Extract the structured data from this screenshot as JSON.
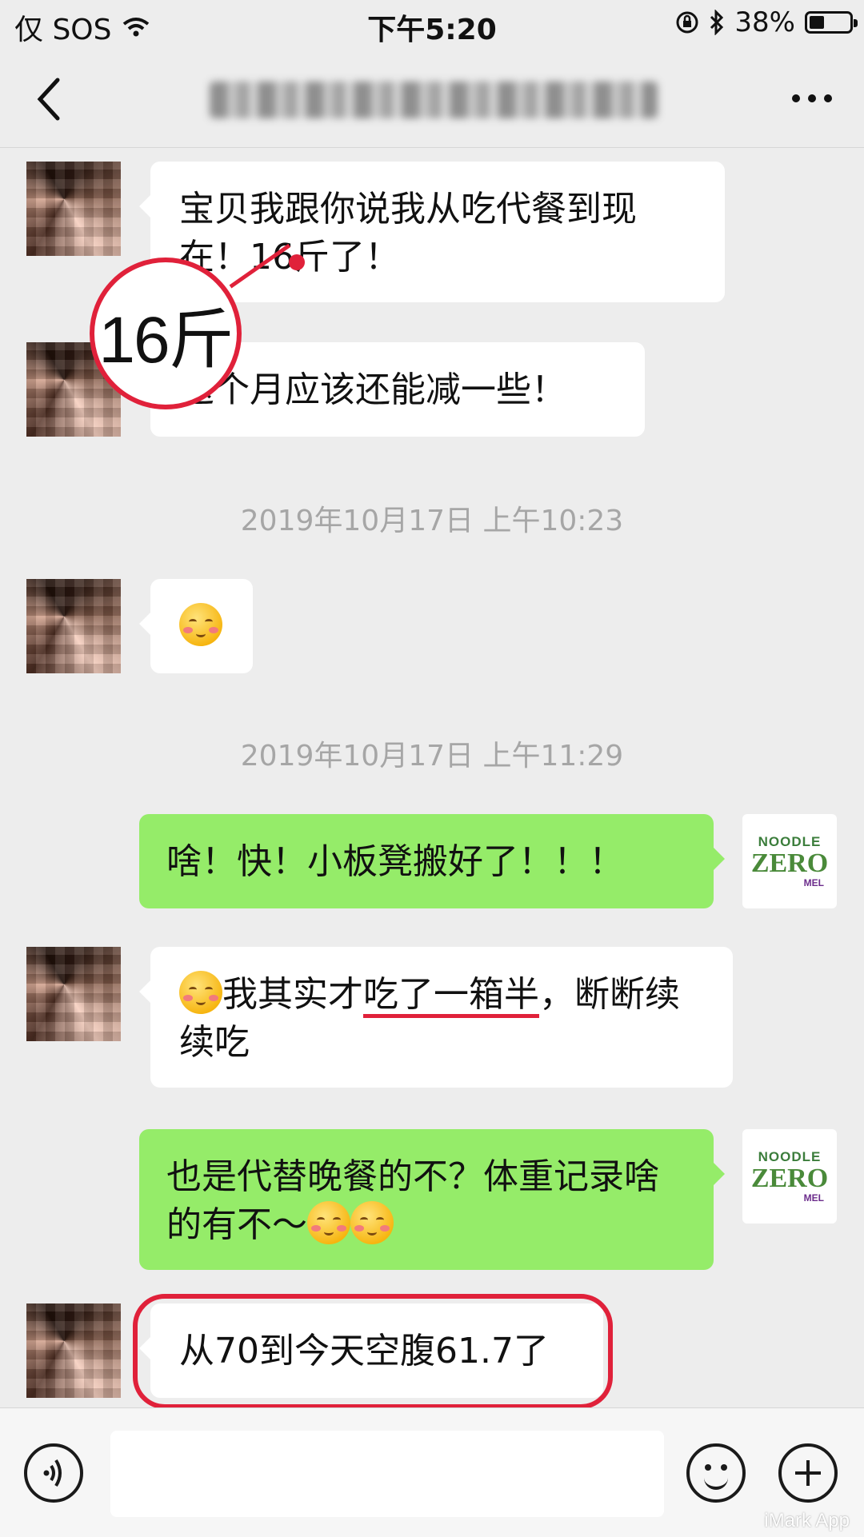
{
  "status_bar": {
    "carrier": "仅 SOS",
    "time": "下午5:20",
    "battery": "38%",
    "battery_level": 0.38
  },
  "nav": {
    "title": "聊天"
  },
  "messages": {
    "m1": "宝贝我跟你说我从吃代餐到现在！16斤了！",
    "m2": "这个月应该还能减一些！",
    "t1": "2019年10月17日 上午10:23",
    "t2": "2019年10月17日 上午11:29",
    "m4": "啥！快！小板凳搬好了！！！",
    "m5a": "我其实才",
    "m5b": "吃了一箱半",
    "m5c": "，断断续续吃",
    "m6": "也是代替晚餐的不？体重记录啥的有不～",
    "m7": "从70到今天空腹61.7了"
  },
  "annotation": {
    "circle_text": "16斤"
  },
  "avatar_right": {
    "line1": "NOODLE",
    "line2": "ZERO",
    "line3": "MEL"
  },
  "watermark": "iMark App",
  "icons": [
    "wifi-icon",
    "lock-rotation-icon",
    "bluetooth-icon",
    "battery-icon",
    "back-icon",
    "more-icon",
    "voice-icon",
    "emoji-icon",
    "plus-icon"
  ]
}
